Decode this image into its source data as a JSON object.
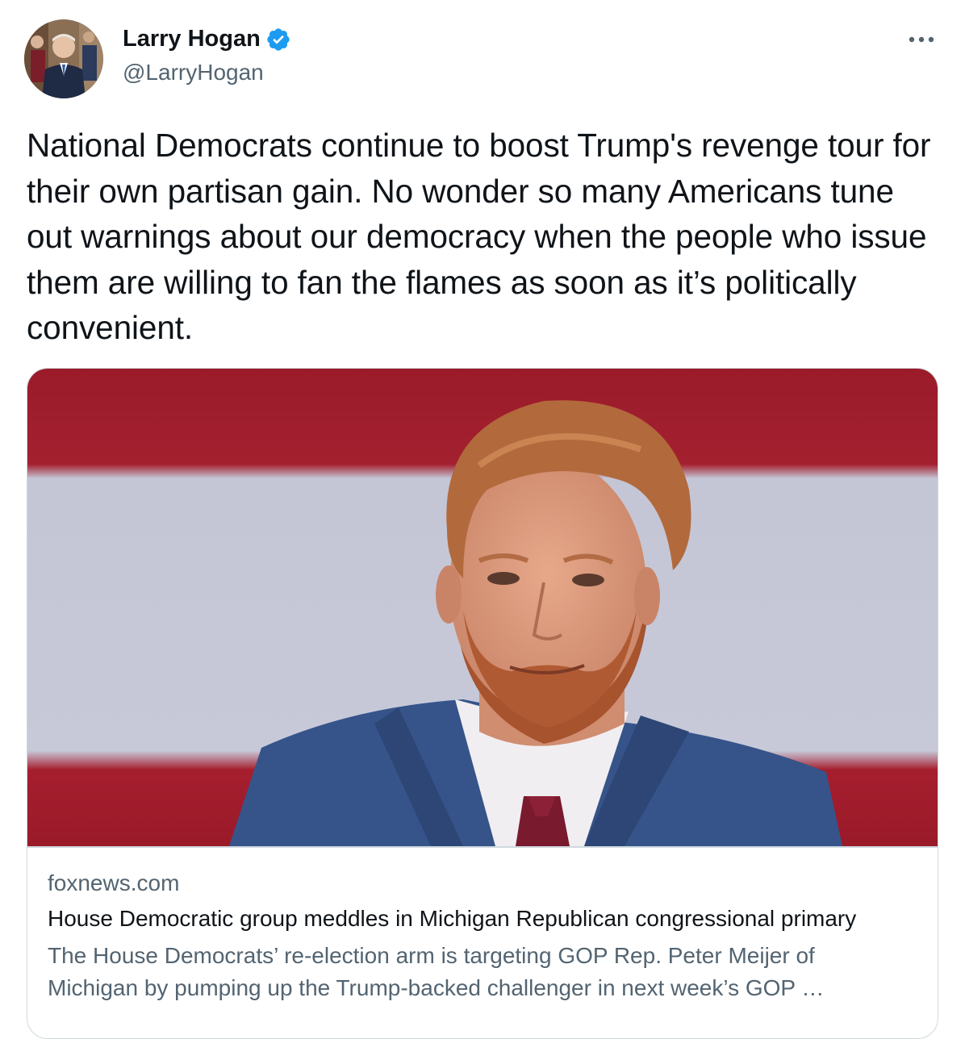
{
  "author": {
    "display_name": "Larry Hogan",
    "handle": "@LarryHogan",
    "verified": true,
    "verified_icon": "verified-badge-icon",
    "verified_color": "#1d9bf0"
  },
  "more_icon": "more-options-icon",
  "tweet": {
    "text": "National Democrats continue to boost Trump's revenge tour for their own partisan gain. No wonder so many Americans tune out warnings about our democracy when the people who issue them are willing to fan the flames as soon as it’s politically convenient."
  },
  "link_card": {
    "image_subject": "man-in-blue-suit-photo",
    "domain": "foxnews.com",
    "title": "House Democratic group meddles in Michigan Republican congressional primary",
    "description": "The House Democrats’ re-election arm is targeting GOP Rep. Peter Meijer of Michigan by pumping up the Trump-backed challenger in next week’s GOP …"
  },
  "colors": {
    "text_primary": "#0f1419",
    "text_secondary": "#536471",
    "border": "#cfd9de"
  }
}
